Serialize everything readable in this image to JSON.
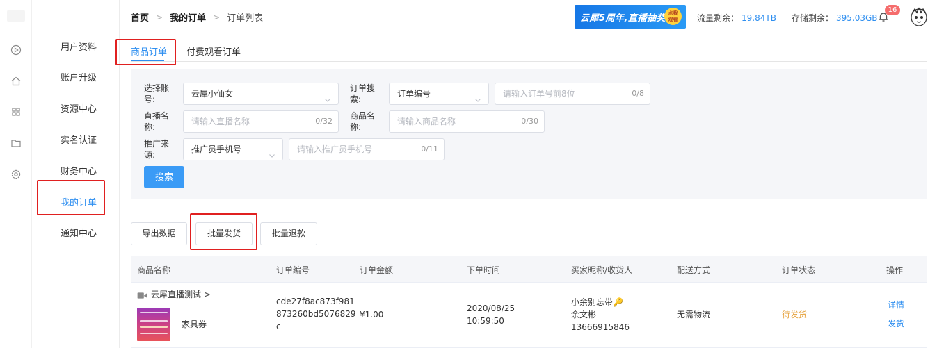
{
  "header": {
    "breadcrumb": [
      "首页",
      "我的订单",
      "订单列表"
    ],
    "banner_text": "云犀5周年,直播抽奖",
    "banner_coin_line1": "点我",
    "banner_coin_line2": "观看",
    "traffic_label": "流量剩余：",
    "traffic_value": "19.84TB",
    "storage_label": "存储剩余：",
    "storage_value": "395.03GB",
    "notification_count": "16"
  },
  "side_menu": [
    "用户资料",
    "账户升级",
    "资源中心",
    "实名认证",
    "财务中心",
    "我的订单",
    "通知中心"
  ],
  "active_menu": "我的订单",
  "tabs": [
    "商品订单",
    "付费观看订单"
  ],
  "active_tab": "商品订单",
  "filter": {
    "account_label": "选择账号:",
    "account_value": "云犀小仙女",
    "order_search_label": "订单搜索:",
    "order_search_type": "订单编号",
    "order_no_placeholder": "请输入订单号前8位",
    "order_no_count": "0/8",
    "live_name_label": "直播名称:",
    "live_name_placeholder": "请输入直播名称",
    "live_name_count": "0/32",
    "product_name_label": "商品名称:",
    "product_name_placeholder": "请输入商品名称",
    "product_name_count": "0/30",
    "source_label": "推广来源:",
    "source_type": "推广员手机号",
    "source_placeholder": "请输入推广员手机号",
    "source_count": "0/11",
    "search_button": "搜索"
  },
  "actions": {
    "export": "导出数据",
    "batch_ship": "批量发货",
    "batch_refund": "批量退款"
  },
  "table": {
    "columns": [
      "商品名称",
      "订单编号",
      "订单金额",
      "下单时间",
      "买家昵称/收货人",
      "配送方式",
      "订单状态",
      "操作"
    ],
    "rows": [
      {
        "live_name": "云犀直播测试 >",
        "product_name": "家具券",
        "order_no_line1": "cde27f8ac873f981",
        "order_no_line2": "873260bd5076829",
        "order_no_line3": "c",
        "amount": "¥1.00",
        "date": "2020/08/25",
        "time": "10:59:50",
        "buyer_nickname": "小余别忘带🔑",
        "receiver_name": "余文彬",
        "receiver_phone": "13666915846",
        "delivery": "无需物流",
        "status": "待发货",
        "action_detail": "详情",
        "action_ship": "发货"
      }
    ]
  },
  "colors": {
    "accent": "#2f8ff0",
    "primary_button": "#3a9bf6",
    "highlight_box": "#e02020",
    "pending_status": "#e6a23c",
    "badge": "#f56c6c"
  }
}
